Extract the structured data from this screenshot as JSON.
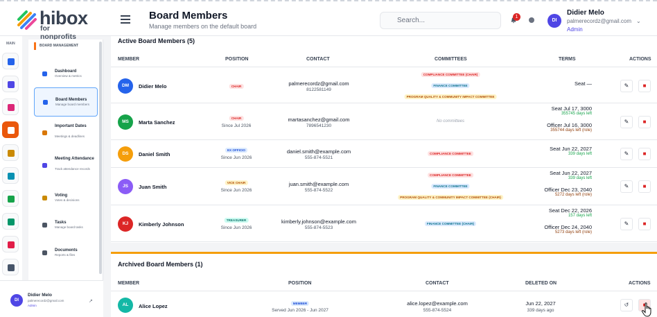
{
  "brand": {
    "word": "hibox",
    "sub": "for nonprofits"
  },
  "header": {
    "title": "Board Members",
    "subtitle": "Manage members on the default board",
    "search_placeholder": "Search...",
    "notif_count": "1"
  },
  "user": {
    "initials": "DI",
    "name": "Didier Melo",
    "email": "palmerecordz@gmail.com",
    "role": "Admin"
  },
  "rail": {
    "label": "MAIN",
    "icons": [
      {
        "name": "home-icon",
        "color": "#2563eb"
      },
      {
        "name": "org-icon",
        "color": "#4f46e5"
      },
      {
        "name": "megaphone-icon",
        "color": "#db2777"
      },
      {
        "name": "board-icon",
        "color": "#ea580c",
        "active": true
      },
      {
        "name": "graduation-icon",
        "color": "#ca8a04"
      },
      {
        "name": "globe-icon",
        "color": "#0891b2"
      },
      {
        "name": "branch-icon",
        "color": "#16a34a"
      },
      {
        "name": "people-icon",
        "color": "#059669"
      },
      {
        "name": "chart-icon",
        "color": "#e11d48"
      },
      {
        "name": "settings-icon",
        "color": "#475569"
      }
    ]
  },
  "nav": {
    "section": "BOARD MANAGEMENT",
    "items": [
      {
        "title": "Dashboard",
        "desc": "Overview & metrics",
        "color": "#2563eb"
      },
      {
        "title": "Board Members",
        "desc": "Manage board members",
        "color": "#2563eb",
        "active": true
      },
      {
        "title": "Important Dates",
        "desc": "Meetings & deadlines",
        "color": "#d97706"
      },
      {
        "title": "Meeting Attendance",
        "desc": "Track attendance records",
        "color": "#4f46e5"
      },
      {
        "title": "Voting",
        "desc": "Votes & decisions",
        "color": "#ca8a04"
      },
      {
        "title": "Tasks",
        "desc": "Manage board tasks",
        "color": "#4b5563"
      },
      {
        "title": "Documents",
        "desc": "Reports & files",
        "color": "#4b5563"
      }
    ]
  },
  "active": {
    "title": "Active Board Members (5)",
    "headers": [
      "MEMBER",
      "POSITION",
      "CONTACT",
      "COMMITTEES",
      "TERMS",
      "ACTIONS"
    ],
    "rows": [
      {
        "initials": "DM",
        "color": "#2563eb",
        "name": "Didier Melo",
        "position": "CHAIR",
        "since": "",
        "email": "palmerecordz@gmail.com",
        "phone": "8122581149",
        "committees": [
          "COMPLIANCE COMMITTEE (CHAIR)",
          "FINANCE COMMITTEE",
          "PROGRAM QUALITY & COMMUNITY IMPACT COMMITTEE"
        ],
        "terms": [
          {
            "label": "Seat —",
            "left": ""
          }
        ]
      },
      {
        "initials": "MS",
        "color": "#16a34a",
        "name": "Marta Sanchez",
        "position": "CHAIR",
        "since": "Since Jul 2026",
        "email": "martasanchez@gmail.com",
        "phone": "7896541230",
        "committees": [],
        "no_committees": "No committees",
        "terms": [
          {
            "label": "Seat Jul 17, 3000",
            "left": "355745 days left"
          },
          {
            "label": "Officer Jul 16, 3000",
            "left": "355744 days left (role)"
          }
        ]
      },
      {
        "initials": "DS",
        "color": "#f59e0b",
        "name": "Daniel Smith",
        "position": "EX OFFICIO",
        "since": "Since Jun 2026",
        "email": "daniel.smith@example.com",
        "phone": "555-874-5521",
        "committees": [
          "COMPLIANCE COMMITTEE"
        ],
        "terms": [
          {
            "label": "Seat Jun 22, 2027",
            "left": "339 days left"
          }
        ]
      },
      {
        "initials": "JS",
        "color": "#8b5cf6",
        "name": "Juan Smith",
        "position": "VICE CHAIR",
        "since": "Since Jun 2026",
        "email": "juan.smith@example.com",
        "phone": "555-874-5522",
        "committees": [
          "COMPLIANCE COMMITTEE",
          "FINANCE COMMITTEE",
          "PROGRAM QUALITY & COMMUNITY IMPACT COMMITTEE (CHAIR)"
        ],
        "terms": [
          {
            "label": "Seat Jun 22, 2027",
            "left": "339 days left"
          },
          {
            "label": "Officer Dec 23, 2040",
            "left": "5272 days left (role)"
          }
        ]
      },
      {
        "initials": "KJ",
        "color": "#dc2626",
        "name": "Kimberly Johnson",
        "position": "TREASURER",
        "since": "Since Jun 2026",
        "email": "kimberly.johnson@example.com",
        "phone": "555-874-5523",
        "committees": [
          "FINANCE COMMITTEE (CHAIR)"
        ],
        "terms": [
          {
            "label": "Seat Dec 22, 2026",
            "left": "157 days left"
          },
          {
            "label": "Officer Dec 24, 2040",
            "left": "5273 days left (role)"
          }
        ]
      }
    ]
  },
  "archived": {
    "title": "Archived Board Members (1)",
    "headers": [
      "MEMBER",
      "POSITION",
      "CONTACT",
      "DELETED ON",
      "ACTIONS"
    ],
    "rows": [
      {
        "initials": "AL",
        "color": "#14b8a6",
        "name": "Alice Lopez",
        "position": "MEMBER",
        "served": "Served Jun 2026 - Jun 2027",
        "email": "alice.lopez@example.com",
        "phone": "555-874-5524",
        "deleted": "Jun 22, 2027",
        "ago": "339 days ago"
      }
    ]
  }
}
